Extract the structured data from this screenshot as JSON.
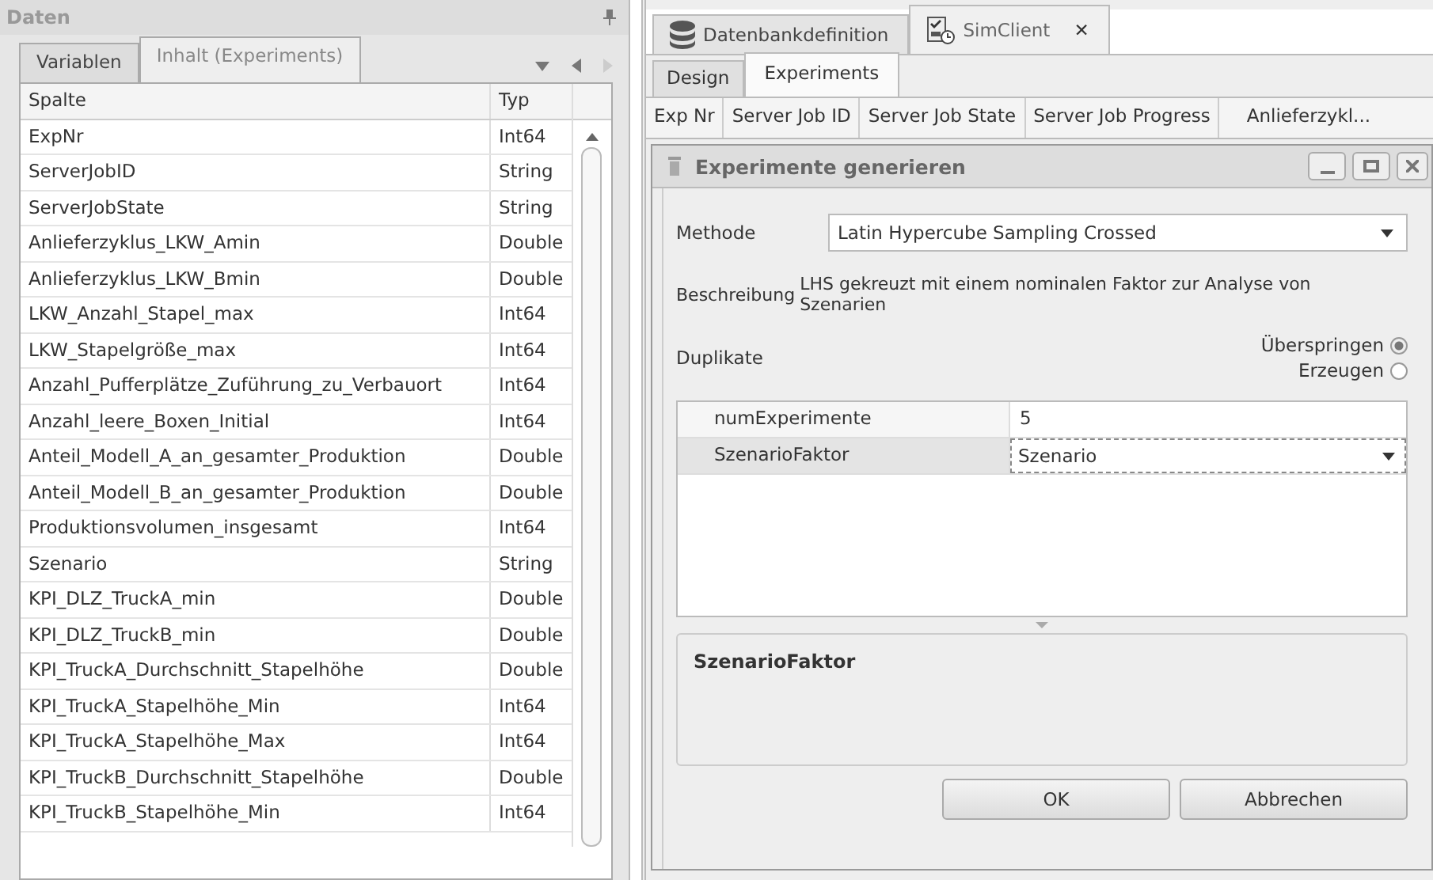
{
  "data_panel": {
    "title": "Daten",
    "tabs": [
      {
        "label": "Variablen",
        "selected": false
      },
      {
        "label": "Inhalt (Experiments)",
        "selected": true
      }
    ],
    "table": {
      "columns": [
        "Spalte",
        "Typ"
      ],
      "rows": [
        [
          "ExpNr",
          "Int64"
        ],
        [
          "ServerJobID",
          "String"
        ],
        [
          "ServerJobState",
          "String"
        ],
        [
          "Anlieferzyklus_LKW_Amin",
          "Double"
        ],
        [
          "Anlieferzyklus_LKW_Bmin",
          "Double"
        ],
        [
          "LKW_Anzahl_Stapel_max",
          "Int64"
        ],
        [
          "LKW_Stapelgröße_max",
          "Int64"
        ],
        [
          "Anzahl_Pufferplätze_Zuführung_zu_Verbauort",
          "Int64"
        ],
        [
          "Anzahl_leere_Boxen_Initial",
          "Int64"
        ],
        [
          "Anteil_Modell_A_an_gesamter_Produktion",
          "Double"
        ],
        [
          "Anteil_Modell_B_an_gesamter_Produktion",
          "Double"
        ],
        [
          "Produktionsvolumen_insgesamt",
          "Int64"
        ],
        [
          "Szenario",
          "String"
        ],
        [
          "KPI_DLZ_TruckA_min",
          "Double"
        ],
        [
          "KPI_DLZ_TruckB_min",
          "Double"
        ],
        [
          "KPI_TruckA_Durchschnitt_Stapelhöhe",
          "Double"
        ],
        [
          "KPI_TruckA_Stapelhöhe_Min",
          "Int64"
        ],
        [
          "KPI_TruckA_Stapelhöhe_Max",
          "Int64"
        ],
        [
          "KPI_TruckB_Durchschnitt_Stapelhöhe",
          "Double"
        ],
        [
          "KPI_TruckB_Stapelhöhe_Min",
          "Int64"
        ]
      ]
    }
  },
  "editor": {
    "doc_tabs": [
      {
        "label": "Datenbankdefinition",
        "selected": false,
        "kind": "database"
      },
      {
        "label": "SimClient",
        "selected": true,
        "kind": "client",
        "close": "✕"
      }
    ],
    "sub_tabs": [
      {
        "label": "Design",
        "selected": false
      },
      {
        "label": "Experiments",
        "selected": true
      }
    ],
    "table": {
      "columns": [
        "Exp Nr",
        "Server Job ID",
        "Server Job State",
        "Server Job Progress",
        "Anlieferzykl..."
      ]
    },
    "dialog": {
      "title": "Experimente generieren",
      "method": {
        "label": "Methode",
        "value": "Latin Hypercube Sampling Crossed"
      },
      "description": {
        "label": "Beschreibung",
        "text": "LHS gekreuzt mit einem nominalen Faktor zur Analyse von Szenarien"
      },
      "duplicates": {
        "label": "Duplikate",
        "options": [
          {
            "label": "Überspringen",
            "selected": true
          },
          {
            "label": "Erzeugen",
            "selected": false
          }
        ]
      },
      "properties": [
        {
          "name": "numExperimente",
          "value": "5",
          "kind": "text",
          "selected": false
        },
        {
          "name": "SzenarioFaktor",
          "value": "Szenario",
          "kind": "dropdown",
          "selected": true
        }
      ],
      "help_title": "SzenarioFaktor",
      "buttons": [
        "OK",
        "Abbrechen"
      ]
    }
  }
}
